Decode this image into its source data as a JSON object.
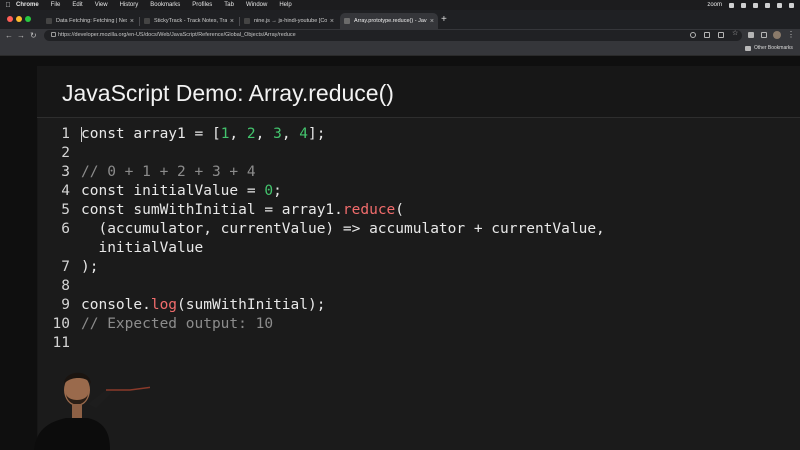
{
  "menubar": {
    "app": "Chrome",
    "items": [
      "File",
      "Edit",
      "View",
      "History",
      "Bookmarks",
      "Profiles",
      "Tab",
      "Window",
      "Help"
    ],
    "zoom_label": "zoom"
  },
  "tabs": [
    {
      "title": "Data Fetching: Fetching | Next",
      "active": false
    },
    {
      "title": "StickyTrack - Track Notes, Tra",
      "active": false
    },
    {
      "title": "nine.js → js-hindi-youtube [Co",
      "active": false
    },
    {
      "title": "Array.prototype.reduce() - Jav",
      "active": true
    }
  ],
  "toolbar": {
    "url": "https://developer.mozilla.org/en-US/docs/Web/JavaScript/Reference/Global_Objects/Array/reduce"
  },
  "bookmarks": {
    "other_label": "Other Bookmarks"
  },
  "page": {
    "heading": "JavaScript Demo: Array.reduce()"
  },
  "code": {
    "lines": [
      {
        "n": "1",
        "parts": [
          [
            "t",
            "const array1 = ["
          ],
          [
            "n",
            "1"
          ],
          [
            "t",
            ", "
          ],
          [
            "n",
            "2"
          ],
          [
            "t",
            ", "
          ],
          [
            "n",
            "3"
          ],
          [
            "t",
            ", "
          ],
          [
            "n",
            "4"
          ],
          [
            "t",
            "];"
          ]
        ]
      },
      {
        "n": "2",
        "parts": []
      },
      {
        "n": "3",
        "parts": [
          [
            "c",
            "// 0 + 1 + 2 + 3 + 4"
          ]
        ]
      },
      {
        "n": "4",
        "parts": [
          [
            "t",
            "const initialValue = "
          ],
          [
            "n",
            "0"
          ],
          [
            "t",
            ";"
          ]
        ]
      },
      {
        "n": "5",
        "parts": [
          [
            "t",
            "const sumWithInitial = array1."
          ],
          [
            "f",
            "reduce"
          ],
          [
            "t",
            "("
          ]
        ]
      },
      {
        "n": "6",
        "parts": [
          [
            "t",
            "  (accumulator, currentValue) => accumulator + currentValue,"
          ]
        ]
      },
      {
        "n": "",
        "parts": [
          [
            "t",
            "  initialValue"
          ]
        ]
      },
      {
        "n": "7",
        "parts": [
          [
            "t",
            ");"
          ]
        ]
      },
      {
        "n": "8",
        "parts": []
      },
      {
        "n": "9",
        "parts": [
          [
            "t",
            "console."
          ],
          [
            "f",
            "log"
          ],
          [
            "t",
            "(sumWithInitial);"
          ]
        ]
      },
      {
        "n": "10",
        "parts": [
          [
            "c",
            "// Expected output: 10"
          ]
        ]
      },
      {
        "n": "11",
        "parts": []
      }
    ]
  },
  "colors": {
    "number": "#43c46d",
    "function": "#f16c6c",
    "comment": "#8c8c8c"
  }
}
